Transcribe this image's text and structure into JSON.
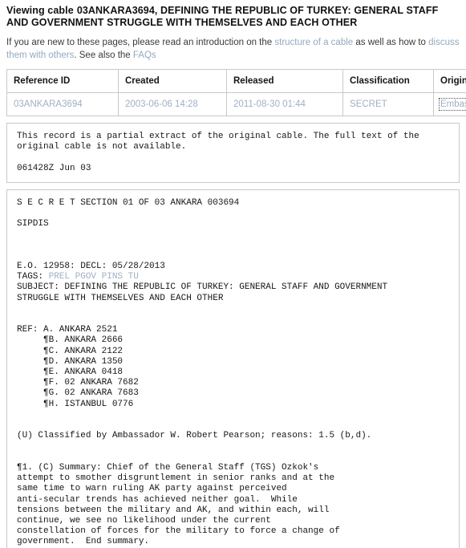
{
  "header": {
    "title_prefix": "Viewing cable",
    "title_id": "03ANKARA3694",
    "title_rest": ", DEFINING THE REPUBLIC OF TURKEY: GENERAL  STAFF AND GOVERNMENT STRUGGLE WITH THEMSELVES AND EACH OTHER",
    "intro_part1": "If you are new to these pages, please read an introduction on the ",
    "intro_link1": "structure of a cable",
    "intro_part2": " as well as how to ",
    "intro_link2": "discuss them with others",
    "intro_part3": ". See also the ",
    "intro_link3": "FAQs"
  },
  "meta_table": {
    "columns": [
      "Reference ID",
      "Created",
      "Released",
      "Classification",
      "Origin"
    ],
    "row": {
      "reference_id": "03ANKARA3694",
      "created": "2003-06-06 14:28",
      "released": "2011-08-30 01:44",
      "classification": "SECRET",
      "origin": "Embassy Ankara"
    }
  },
  "notice": {
    "text": "This record is a partial extract of the original cable. The full text of the\noriginal cable is not available.\n\n061428Z Jun 03"
  },
  "cable": {
    "line_header": "S E C R E T SECTION 01 OF 03 ANKARA 003694",
    "sipdis": "SIPDIS",
    "eo_line": "E.O. 12958: DECL: 05/28/2013",
    "tags_label": "TAGS: ",
    "tags_value": "PREL PGOV PINS TU",
    "subject": "SUBJECT: DEFINING THE REPUBLIC OF TURKEY: GENERAL STAFF AND GOVERNMENT\nSTRUGGLE WITH THEMSELVES AND EACH OTHER",
    "refs": "REF: A. ANKARA 2521\n     ¶B. ANKARA 2666\n     ¶C. ANKARA 2122\n     ¶D. ANKARA 1350\n     ¶E. ANKARA 0418\n     ¶F. 02 ANKARA 7682\n     ¶G. 02 ANKARA 7683\n     ¶H. ISTANBUL 0776",
    "classified_by": "(U) Classified by Ambassador W. Robert Pearson; reasons: 1.5 (b,d).",
    "summary": "¶1. (C) Summary: Chief of the General Staff (TGS) Ozkok's\nattempt to smother disgruntlement in senior ranks and at the\nsame time to warn ruling AK party against perceived\nanti-secular trends has achieved neither goal.  While\ntensions between the military and AK, and within each, will\ncontinue, we see no likelihood under the current\nconstellation of forces for the military to force a change of\ngovernment.  End summary."
  },
  "colors": {
    "link": "#93a9c0",
    "cell_link": "#9fb0c4",
    "border": "#c9c9c9",
    "text": "#161616"
  }
}
